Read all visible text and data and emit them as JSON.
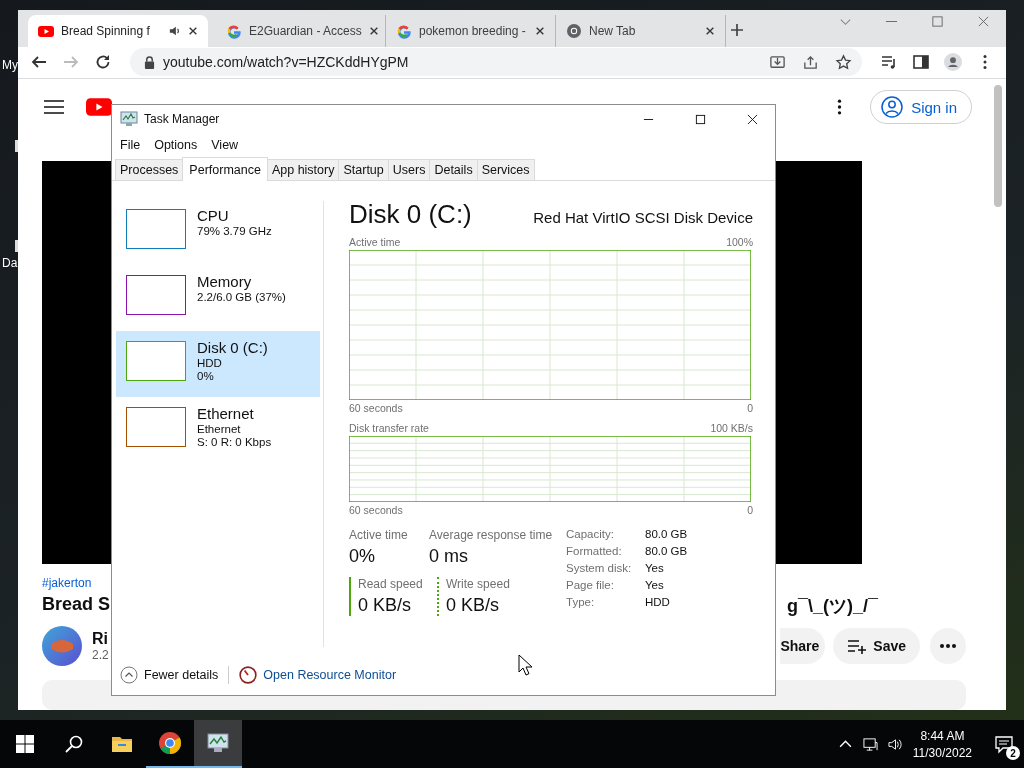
{
  "desktop": {
    "icon_labels": [
      "My",
      "Da"
    ]
  },
  "browser": {
    "tabs": [
      {
        "title": "Bread Spinning f",
        "kind": "youtube",
        "audio": true,
        "selected": true
      },
      {
        "title": "E2Guardian - Access",
        "kind": "google",
        "audio": false,
        "selected": false
      },
      {
        "title": "pokemon breeding -",
        "kind": "google",
        "audio": false,
        "selected": false
      },
      {
        "title": "New Tab",
        "kind": "chrome",
        "audio": false,
        "selected": false
      }
    ],
    "url": "youtube.com/watch?v=HZCKddHYgPM"
  },
  "youtube": {
    "sign_in": "Sign in",
    "hashtag": "#jakerton",
    "title_start": "Bread S",
    "title_end": "g¯\\_(ツ)_/¯",
    "channel": "Ri",
    "subscribers": "2.2",
    "share": "Share",
    "save": "Save"
  },
  "task_manager": {
    "title": "Task Manager",
    "menu": [
      "File",
      "Options",
      "View"
    ],
    "tabs": [
      {
        "label": "Processes",
        "selected": false
      },
      {
        "label": "Performance",
        "selected": true
      },
      {
        "label": "App history",
        "selected": false
      },
      {
        "label": "Startup",
        "selected": false
      },
      {
        "label": "Users",
        "selected": false
      },
      {
        "label": "Details",
        "selected": false
      },
      {
        "label": "Services",
        "selected": false
      }
    ],
    "resources": [
      {
        "name": "CPU",
        "lines": [
          "79% 3.79 GHz"
        ],
        "color": "#117dbb",
        "selected": false
      },
      {
        "name": "Memory",
        "lines": [
          "2.2/6.0 GB (37%)"
        ],
        "color": "#8b12ae",
        "selected": false
      },
      {
        "name": "Disk 0 (C:)",
        "lines": [
          "HDD",
          "0%"
        ],
        "color": "#4da60c",
        "selected": true
      },
      {
        "name": "Ethernet",
        "lines": [
          "Ethernet",
          "S: 0 R: 0 Kbps"
        ],
        "color": "#a74f01",
        "selected": false
      }
    ],
    "heading": "Disk 0 (C:)",
    "device": "Red Hat VirtIO SCSI Disk Device",
    "graphs": [
      {
        "label": "Active time",
        "max": "100%",
        "span": "60 seconds",
        "min": "0"
      },
      {
        "label": "Disk transfer rate",
        "max": "100 KB/s",
        "span": "60 seconds",
        "min": "0"
      }
    ],
    "stats": [
      {
        "label": "Active time",
        "value": "0%"
      },
      {
        "label": "Average response time",
        "value": "0 ms"
      }
    ],
    "speeds": [
      {
        "kind": "read",
        "label": "Read speed",
        "value": "0 KB/s"
      },
      {
        "kind": "write",
        "label": "Write speed",
        "value": "0 KB/s"
      }
    ],
    "properties": [
      {
        "label": "Capacity:",
        "value": "80.0 GB"
      },
      {
        "label": "Formatted:",
        "value": "80.0 GB"
      },
      {
        "label": "System disk:",
        "value": "Yes"
      },
      {
        "label": "Page file:",
        "value": "Yes"
      },
      {
        "label": "Type:",
        "value": "HDD"
      }
    ],
    "footer": {
      "fewer_details": "Fewer details",
      "resource_monitor": "Open Resource Monitor"
    }
  },
  "taskbar": {
    "apps": [
      {
        "kind": "explorer",
        "running": false,
        "selected": false
      },
      {
        "kind": "chrome",
        "running": true,
        "selected": false
      },
      {
        "kind": "taskmgr",
        "running": true,
        "selected": true
      }
    ],
    "time": "8:44 AM",
    "date": "11/30/2022",
    "notifications": "2"
  }
}
